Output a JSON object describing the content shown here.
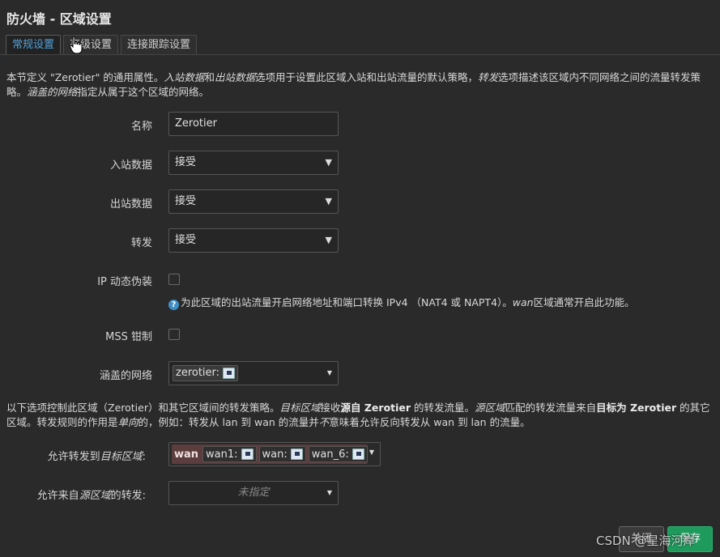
{
  "page": {
    "title": "防火墙 - 区域设置"
  },
  "tabs": [
    {
      "label": "常规设置",
      "active": true
    },
    {
      "label": "高级设置",
      "active": false
    },
    {
      "label": "连接跟踪设置",
      "active": false
    }
  ],
  "desc1": {
    "p1": "本节定义 \"Zerotier\" 的通用属性。",
    "em1": "入站数据",
    "p2": "和",
    "em2": "出站数据",
    "p3": "选项用于设置此区域入站和出站流量的默认策略，",
    "em3": "转发",
    "p4": "选项描述该区域内不同网络之间的流量转发策略。",
    "em4": "涵盖的网络",
    "p5": "指定从属于这个区域的网络。"
  },
  "form": {
    "name_label": "名称",
    "name_value": "Zerotier",
    "input_label": "入站数据",
    "input_value": "接受",
    "output_label": "出站数据",
    "output_value": "接受",
    "forward_label": "转发",
    "forward_value": "接受",
    "masq_label": "IP 动态伪装",
    "masq_help_prefix": "为此区域的出站流量开启网络地址和端口转换 IPv4 （NAT4 或 NAPT4）。",
    "masq_help_em": "wan",
    "masq_help_suffix": "区域通常开启此功能。",
    "mss_label": "MSS 钳制",
    "networks_label": "涵盖的网络",
    "networks_chip": "zerotier:"
  },
  "desc2": {
    "p1": "以下选项控制此区域（Zerotier）和其它区域间的转发策略。",
    "em1": "目标区域",
    "p2": "接收",
    "b1": "源自 Zerotier",
    "p3": " 的转发流量。",
    "em2": "源区域",
    "p4": "匹配的转发流量来自",
    "b2": "目标为 Zerotier",
    "p5": " 的其它区域。转发规则的作用是",
    "em3": "单向",
    "p6": "的，例如：转发从 lan 到 wan 的流量并",
    "em4": "不",
    "p7": "意味着允许反向转发从 wan 到 lan 的流量。"
  },
  "forwarding": {
    "dest_label_prefix": "允许转发到",
    "dest_label_em": "目标区域",
    "dest_label_suffix": ":",
    "dest_zone": "wan",
    "dest_chips": [
      "wan1:",
      "wan:",
      "wan_6:"
    ],
    "src_label_prefix": "允许来自",
    "src_label_em": "源区域",
    "src_label_suffix": "的转发:",
    "src_placeholder": "未指定"
  },
  "buttons": {
    "close": "关闭",
    "save": "保存"
  },
  "watermark": "CSDN @星海河岸"
}
